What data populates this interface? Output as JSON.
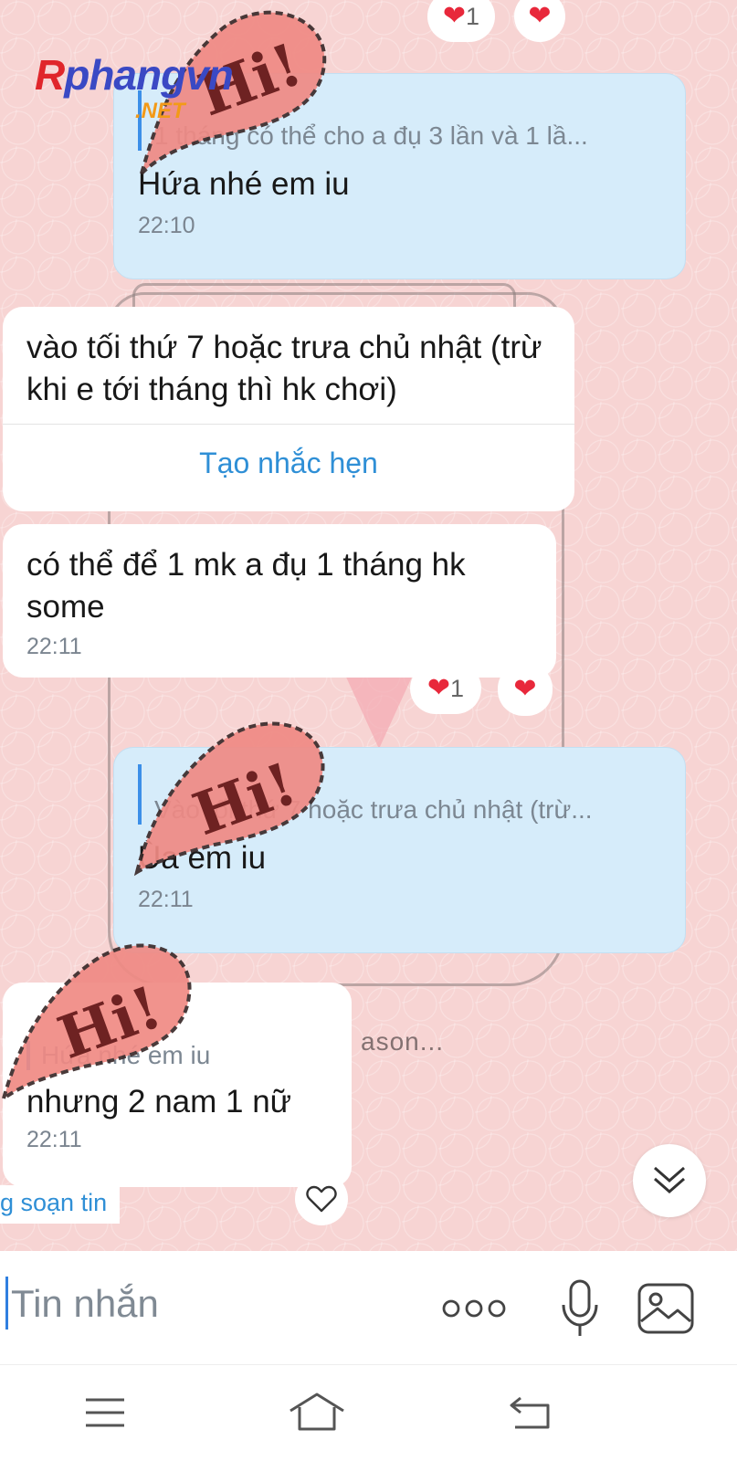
{
  "watermark": {
    "logo_r": "R",
    "logo_rest": "phangvn",
    "logo_net": ".NET",
    "sticker_text": "Hi!"
  },
  "background": {
    "jar_text": "ason..."
  },
  "top_reactions": {
    "count": "1"
  },
  "messages": [
    {
      "type": "sent",
      "quote_author": "",
      "quote_text": "1 tháng có thể cho a đụ 3 lần và 1 lầ...",
      "text": "Hứa nhé em iu",
      "time": "22:10"
    },
    {
      "type": "received",
      "text": "vào tối thứ 7 hoặc trưa chủ nhật (trừ khi e tới tháng thì hk chơi)",
      "action": "Tạo nhắc hẹn"
    },
    {
      "type": "received",
      "text": "có thể để 1 mk a đụ 1 tháng hk some",
      "time": "22:11",
      "reaction_count": "1"
    },
    {
      "type": "sent",
      "quote_author": "",
      "quote_text": "Vào tối thứ 7 hoặc trưa chủ nhật (trừ...",
      "text": "Ùa em iu",
      "time": "22:11"
    },
    {
      "type": "received",
      "quote_text": "Hứa nhé em iu",
      "text": "nhưng 2 nam 1 nữ",
      "time": "22:11"
    }
  ],
  "status": {
    "composing": "g soạn tin"
  },
  "composer": {
    "placeholder": "Tin nhắn"
  },
  "icons": {
    "more": "more-dots-icon",
    "mic": "microphone-icon",
    "image": "image-icon",
    "scroll_down": "double-chevron-down-icon",
    "like": "heart-outline-icon",
    "nav_menu": "menu-icon",
    "nav_home": "home-icon",
    "nav_back": "back-icon"
  },
  "colors": {
    "sent_bubble": "#d6ecfa",
    "received_bubble": "#ffffff",
    "accent": "#2f8fd6",
    "heart": "#e8283b",
    "chat_background": "#f7d4d3"
  }
}
